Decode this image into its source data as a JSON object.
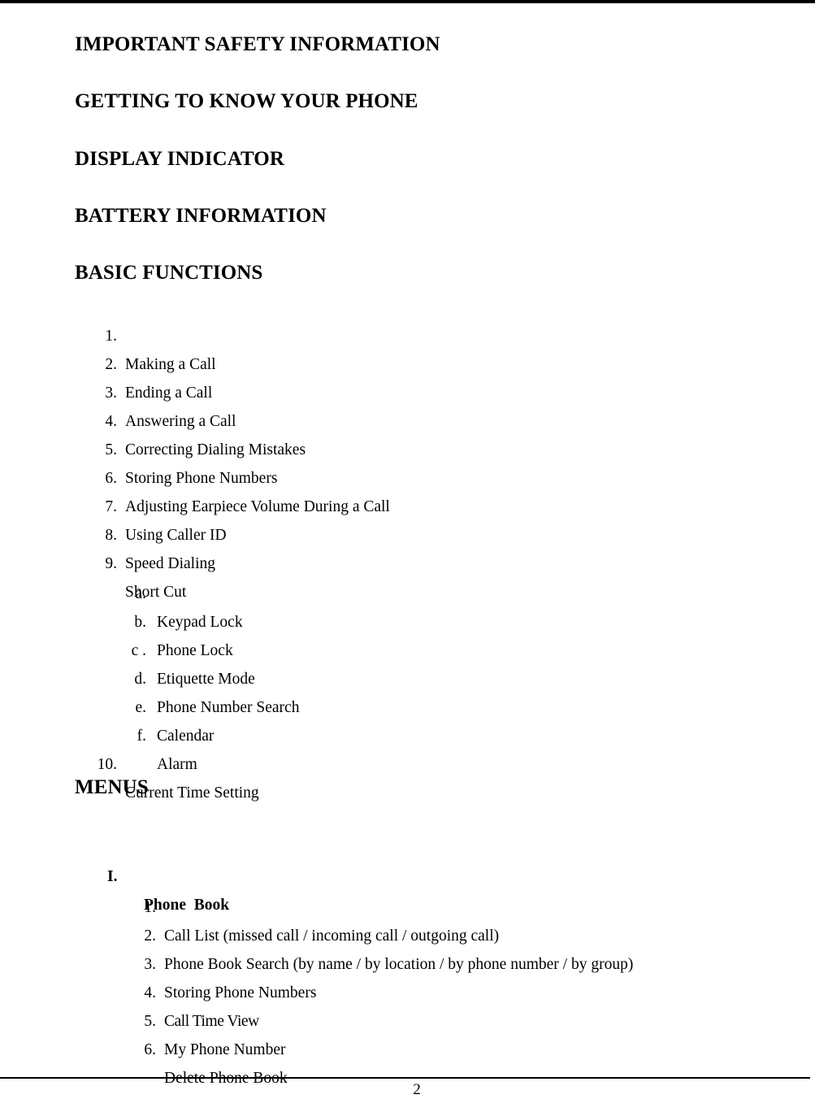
{
  "document": {
    "type": "table-of-contents",
    "page_number": "2"
  },
  "headings": {
    "important_safety": "IMPORTANT SAFETY INFORMATION",
    "getting_to_know": "GETTING TO KNOW YOUR PHONE",
    "display_indicator": "DISPLAY INDICATOR",
    "battery_information": "BATTERY INFORMATION",
    "basic_functions": "BASIC FUNCTIONS",
    "menus": "MENUS"
  },
  "basic_functions_items": [
    {
      "marker": "1.",
      "label": "Making a Call"
    },
    {
      "marker": "2.",
      "label": "Ending a Call"
    },
    {
      "marker": "3.",
      "label": "Answering a Call"
    },
    {
      "marker": "4.",
      "label": "Correcting Dialing Mistakes"
    },
    {
      "marker": "5.",
      "label": "Storing Phone Numbers"
    },
    {
      "marker": "6.",
      "label": "Adjusting Earpiece Volume During a Call"
    },
    {
      "marker": "7.",
      "label": "Using Caller ID"
    },
    {
      "marker": "8.",
      "label": "Speed Dialing"
    },
    {
      "marker": "9.",
      "label": "Short Cut"
    }
  ],
  "short_cut_subitems": [
    {
      "marker": "a.",
      "label": "Keypad Lock"
    },
    {
      "marker": "b.",
      "label": "Phone Lock"
    },
    {
      "marker": "c .",
      "label": "Etiquette Mode"
    },
    {
      "marker": "d.",
      "label": "Phone Number Search"
    },
    {
      "marker": "e.",
      "label": "Calendar"
    },
    {
      "marker": "f.",
      "label": "Alarm"
    }
  ],
  "basic_functions_last_item": {
    "marker": "10.",
    "label": "Current Time Setting"
  },
  "menu_section": {
    "marker": "I.",
    "title": "Phone  Book",
    "items": [
      {
        "marker": "1.",
        "label": "Call List (missed call / incoming call / outgoing call)"
      },
      {
        "marker": "2.",
        "label": "Phone Book Search (by name / by location / by phone number / by group)"
      },
      {
        "marker": "3.",
        "label": "Storing Phone Numbers"
      },
      {
        "marker": "4.",
        "label": "Call Time View"
      },
      {
        "marker": "5.",
        "label": "My Phone Number"
      },
      {
        "marker": "6.",
        "label": "Delete Phone Book"
      }
    ]
  },
  "footer": {
    "page_number": "2"
  }
}
